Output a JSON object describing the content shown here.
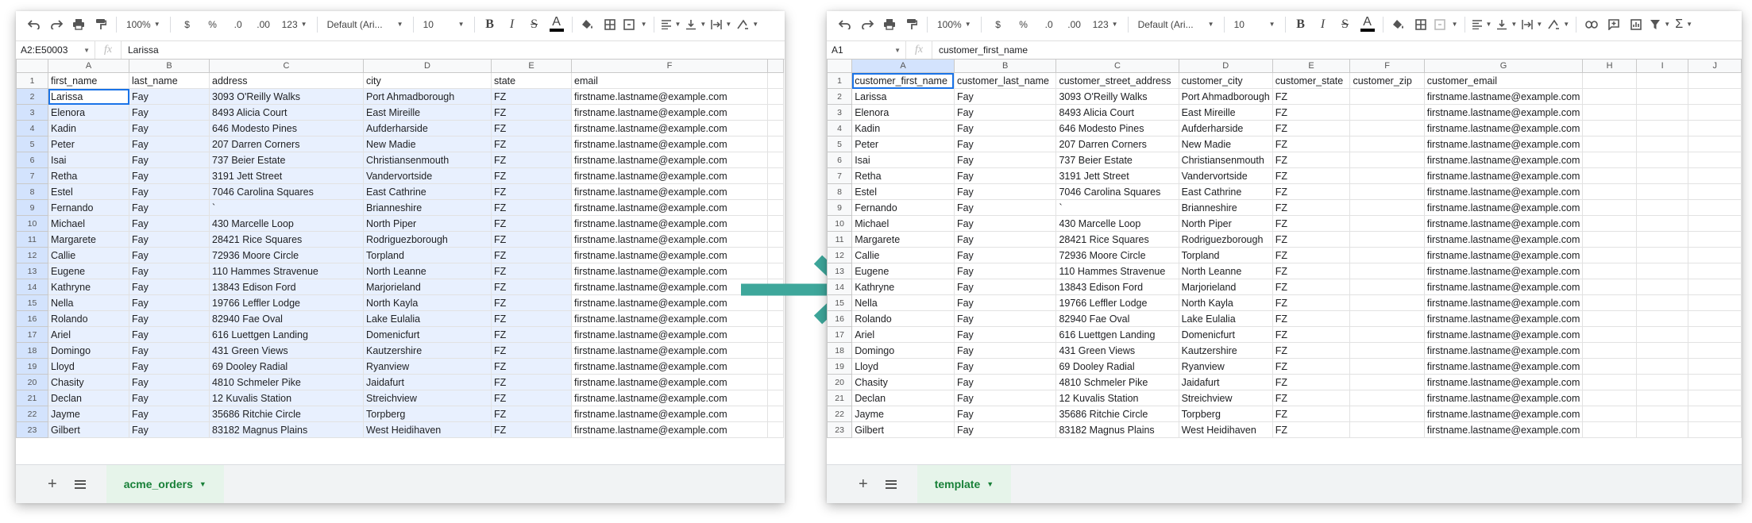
{
  "colors": {
    "arrow": "#3ea79b",
    "selection_blue": "#1a73e8",
    "tab_green": "#188038"
  },
  "toolbar": {
    "zoom": "100%",
    "currency": "$",
    "percent": "%",
    "dec_less": ".0",
    "dec_more": ".00",
    "more_formats": "123",
    "font": "Default (Ari...",
    "font_size": "10",
    "bold": "B",
    "italic": "I",
    "strike": "S",
    "text_color": "A"
  },
  "rows": [
    [
      "Larissa",
      "Fay",
      "3093 O'Reilly Walks",
      "Port Ahmadborough",
      "FZ"
    ],
    [
      "Elenora",
      "Fay",
      "8493 Alicia Court",
      "East Mireille",
      "FZ"
    ],
    [
      "Kadin",
      "Fay",
      "646 Modesto Pines",
      "Aufderharside",
      "FZ"
    ],
    [
      "Peter",
      "Fay",
      "207 Darren Corners",
      "New Madie",
      "FZ"
    ],
    [
      "Isai",
      "Fay",
      "737 Beier Estate",
      "Christiansenmouth",
      "FZ"
    ],
    [
      "Retha",
      "Fay",
      "3191 Jett Street",
      "Vandervortside",
      "FZ"
    ],
    [
      "Estel",
      "Fay",
      "7046 Carolina Squares",
      "East Cathrine",
      "FZ"
    ],
    [
      "Fernando",
      "Fay",
      "`",
      "Brianneshire",
      "FZ"
    ],
    [
      "Michael",
      "Fay",
      "430 Marcelle Loop",
      "North Piper",
      "FZ"
    ],
    [
      "Margarete",
      "Fay",
      "28421 Rice Squares",
      "Rodriguezborough",
      "FZ"
    ],
    [
      "Callie",
      "Fay",
      "72936 Moore Circle",
      "Torpland",
      "FZ"
    ],
    [
      "Eugene",
      "Fay",
      "110 Hammes Stravenue",
      "North Leanne",
      "FZ"
    ],
    [
      "Kathryne",
      "Fay",
      "13843 Edison Ford",
      "Marjorieland",
      "FZ"
    ],
    [
      "Nella",
      "Fay",
      "19766 Leffler Lodge",
      "North Kayla",
      "FZ"
    ],
    [
      "Rolando",
      "Fay",
      "82940 Fae Oval",
      "Lake Eulalia",
      "FZ"
    ],
    [
      "Ariel",
      "Fay",
      "616 Luettgen Landing",
      "Domenicfurt",
      "FZ"
    ],
    [
      "Domingo",
      "Fay",
      "431 Green Views",
      "Kautzershire",
      "FZ"
    ],
    [
      "Lloyd",
      "Fay",
      "69 Dooley Radial",
      "Ryanview",
      "FZ"
    ],
    [
      "Chasity",
      "Fay",
      "4810 Schmeler Pike",
      "Jaidafurt",
      "FZ"
    ],
    [
      "Declan",
      "Fay",
      "12 Kuvalis Station",
      "Streichview",
      "FZ"
    ],
    [
      "Jayme",
      "Fay",
      "35686 Ritchie Circle",
      "Torpberg",
      "FZ"
    ],
    [
      "Gilbert",
      "Fay",
      "83182 Magnus Plains",
      "West Heidihaven",
      "FZ"
    ]
  ],
  "email_value": "firstname.lastname@example.com",
  "left": {
    "name_box": "A2:E50003",
    "formula": "Larissa",
    "columns": [
      "A",
      "B",
      "C",
      "D",
      "E",
      "F"
    ],
    "headers": [
      "first_name",
      "last_name",
      "address",
      "city",
      "state",
      "email"
    ],
    "sheet_tab": "acme_orders"
  },
  "right": {
    "name_box": "A1",
    "formula": "customer_first_name",
    "columns": [
      "A",
      "B",
      "C",
      "D",
      "E",
      "F",
      "G",
      "H",
      "I",
      "J"
    ],
    "headers": [
      "customer_first_name",
      "customer_last_name",
      "customer_street_address",
      "customer_city",
      "customer_state",
      "customer_zip",
      "customer_email",
      "",
      "",
      ""
    ],
    "sheet_tab": "template"
  }
}
